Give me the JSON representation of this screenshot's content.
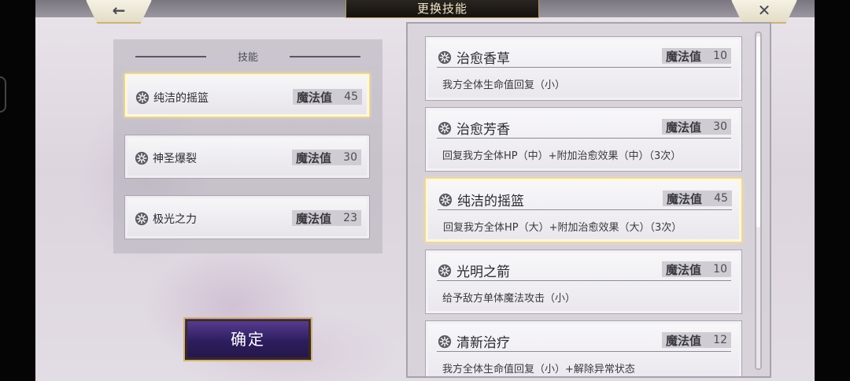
{
  "header": {
    "title": "更换技能",
    "back_icon": "←",
    "close_icon": "✕"
  },
  "equipped": {
    "header": "技能",
    "mp_label": "魔法值",
    "slots": [
      {
        "name": "纯洁的摇篮",
        "mp": "45",
        "selected": true
      },
      {
        "name": "神圣爆裂",
        "mp": "30",
        "selected": false
      },
      {
        "name": "极光之力",
        "mp": "23",
        "selected": false
      }
    ]
  },
  "confirm_label": "确定",
  "skill_list": {
    "mp_label": "魔法值",
    "items": [
      {
        "name": "治愈香草",
        "mp": "10",
        "desc": "我方全体生命值回复（小）",
        "selected": false
      },
      {
        "name": "治愈芳香",
        "mp": "30",
        "desc": "回复我方全体HP（中）+附加治愈效果（中）（3次）",
        "selected": false
      },
      {
        "name": "纯洁的摇篮",
        "mp": "45",
        "desc": "回复我方全体HP（大）+附加治愈效果（大）（3次）",
        "selected": true
      },
      {
        "name": "光明之箭",
        "mp": "10",
        "desc": "给予敌方单体魔法攻击（小）",
        "selected": false
      },
      {
        "name": "清新治疗",
        "mp": "12",
        "desc": "我方全体生命值回复（小）+解除异常状态",
        "selected": false
      }
    ]
  },
  "colors": {
    "selected_border": "#f2d98c",
    "confirm_bg": "#2d1d5e",
    "title_plate": "#15110e"
  }
}
